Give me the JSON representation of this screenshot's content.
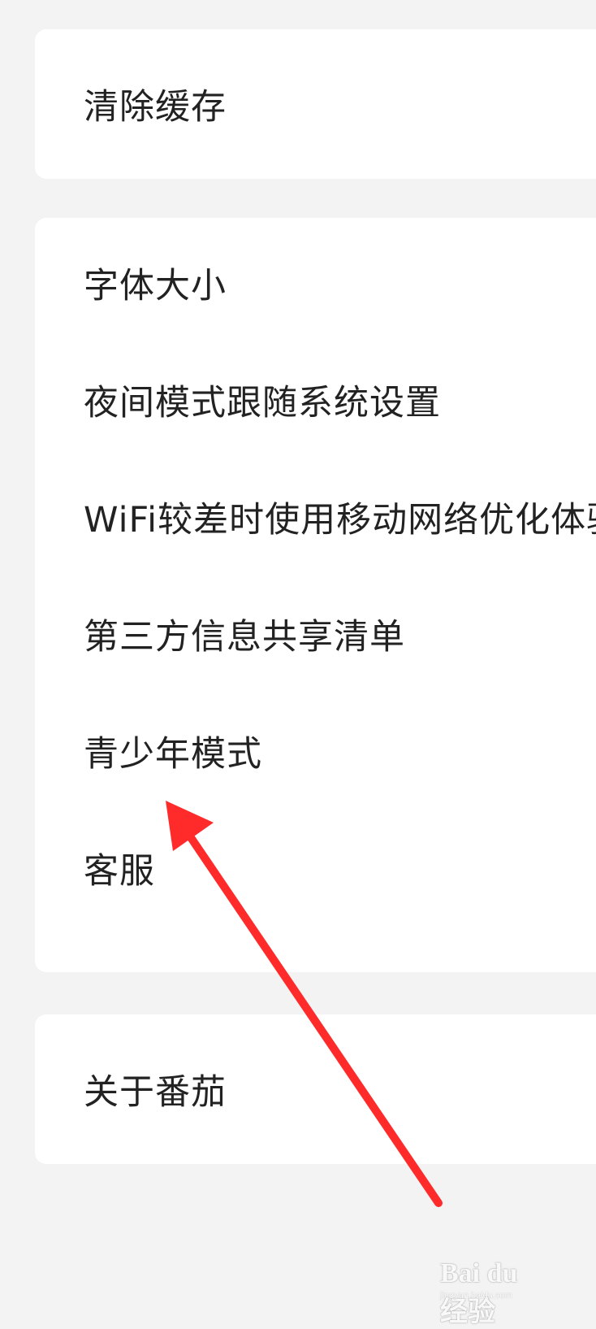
{
  "settings": {
    "cache_section": {
      "clear_cache": "清除缓存"
    },
    "general_section": {
      "font_size": "字体大小",
      "night_mode_follow_system": "夜间模式跟随系统设置",
      "wifi_mobile_optimization": "WiFi较差时使用移动网络优化体验",
      "third_party_sharing_list": "第三方信息共享清单",
      "teen_mode": "青少年模式",
      "customer_service": "客服"
    },
    "about_section": {
      "about": "关于番茄"
    }
  },
  "annotation": {
    "arrow_color": "#ff2a2a",
    "arrow_icon": "red-arrow-pointing-to-teen-mode"
  },
  "watermark": {
    "brand": "Bai du 经验",
    "url": "jingyan.baidu.com"
  },
  "colors": {
    "background": "#f3f3f3",
    "card": "#ffffff",
    "text": "#222222"
  }
}
